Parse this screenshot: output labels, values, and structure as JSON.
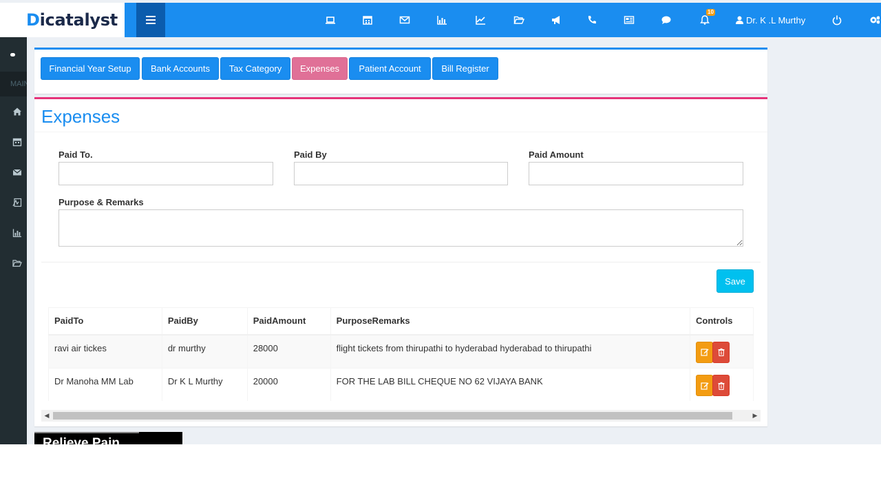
{
  "brand": {
    "logo_prefix": "D",
    "logo_rest": "icatalyst"
  },
  "topbar": {
    "icons": [
      "laptop-icon",
      "calendar-icon",
      "envelope-icon",
      "bar-chart-icon",
      "line-chart-icon",
      "folder-open-icon",
      "bullhorn-icon",
      "phone-icon",
      "newspaper-icon",
      "comment-icon",
      "bell-icon"
    ],
    "notifications_count": "10",
    "user_name": "Dr. K .L Murthy",
    "accent_color": "#1a8df0"
  },
  "sidebar": {
    "main_label": "MAIN",
    "items": [
      "home-icon",
      "calendar-icon",
      "envelope-icon",
      "pdf-icon",
      "bar-chart-icon",
      "folder-icon"
    ]
  },
  "tabs": [
    {
      "label": "Financial Year Setup",
      "active": false
    },
    {
      "label": "Bank Accounts",
      "active": false
    },
    {
      "label": "Tax Category",
      "active": false
    },
    {
      "label": "Expenses",
      "active": true
    },
    {
      "label": "Patient Account",
      "active": false
    },
    {
      "label": "Bill Register",
      "active": false
    }
  ],
  "form": {
    "title": "Expenses",
    "paid_to_label": "Paid To.",
    "paid_to_value": "",
    "paid_by_label": "Paid By",
    "paid_by_value": "",
    "paid_amount_label": "Paid Amount",
    "paid_amount_value": "",
    "remarks_label": "Purpose & Remarks",
    "remarks_value": "",
    "save_label": "Save"
  },
  "table": {
    "headers": [
      "PaidTo",
      "PaidBy",
      "PaidAmount",
      "PurposeRemarks",
      "Controls"
    ],
    "rows": [
      {
        "paid_to": "ravi air tickes",
        "paid_by": "dr murthy",
        "amount": "28000",
        "remarks": "flight tickets from thirupathi to hyderabad hyderabad to thirupathi"
      },
      {
        "paid_to": "Dr Manoha MM Lab",
        "paid_by": "Dr K L Murthy",
        "amount": "20000",
        "remarks": "FOR THE LAB BILL CHEQUE NO 62 VIJAYA BANK"
      }
    ]
  },
  "ad": {
    "text": "Relieve Pain"
  }
}
